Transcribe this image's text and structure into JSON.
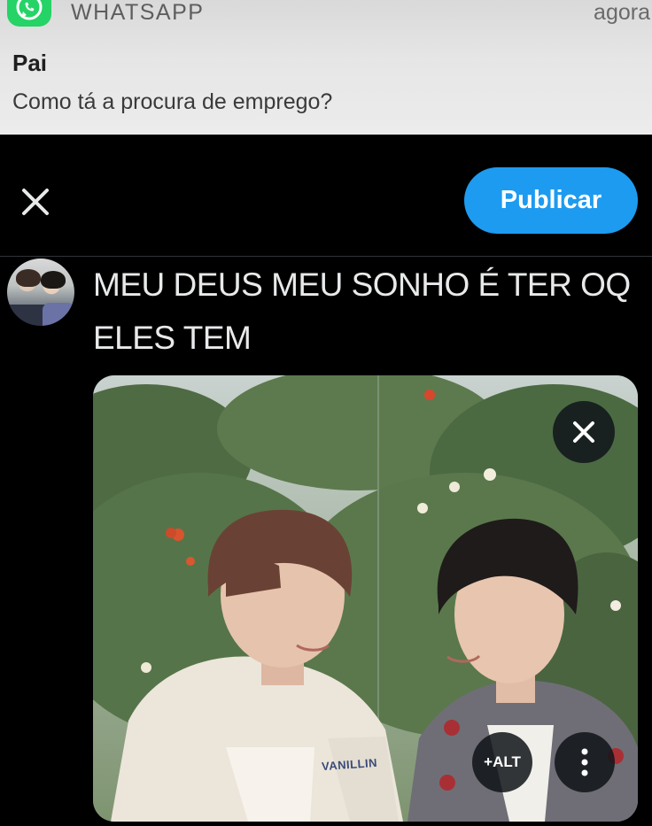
{
  "notification": {
    "app_name": "WHATSAPP",
    "time": "agora",
    "sender": "Pai",
    "message": "Como tá a procura de emprego?",
    "icon": "whatsapp-icon",
    "accent": "#25d366"
  },
  "composer": {
    "close_icon": "close-icon",
    "publish_label": "Publicar",
    "publish_color": "#1d9bf0",
    "tweet_text": "MEU DEUS MEU SONHO É TER OQ ELES TEM"
  },
  "media": {
    "remove_icon": "close-icon",
    "alt_label": "+ALT",
    "more_icon": "more-vertical-icon",
    "jacket_text": "VANILLIN"
  }
}
